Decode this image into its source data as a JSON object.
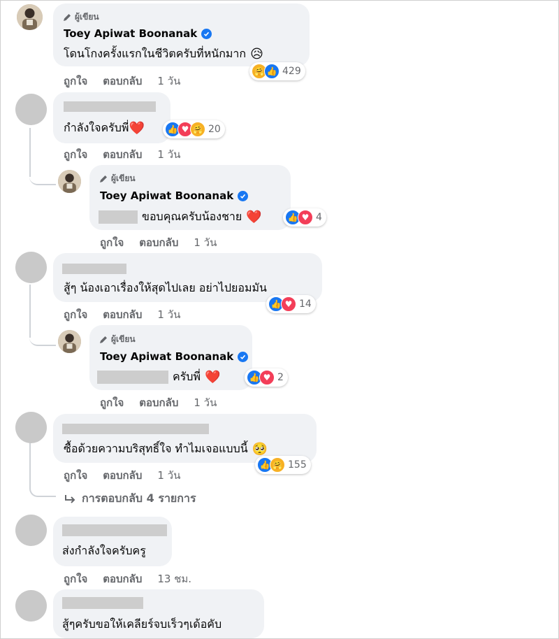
{
  "labels": {
    "author_tag": "ผู้เขียน",
    "like": "ถูกใจ",
    "reply": "ตอบกลับ"
  },
  "comments": [
    {
      "name": "Toey Apiwat Boonanak",
      "text": "โดนโกงครั้งแรกในชีวิตครับที่หนักมาก",
      "emoji": "😥",
      "time": "1 วัน",
      "reactions": [
        "care",
        "like"
      ],
      "count": "429"
    },
    {
      "text": "กำลังใจครับพี่",
      "emoji": "❤️",
      "time": "1 วัน",
      "reactions": [
        "like",
        "love",
        "care"
      ],
      "count": "20"
    },
    {
      "name": "Toey Apiwat Boonanak",
      "text": "ขอบคุณครับน้องชาย",
      "emoji": "❤️",
      "time": "1 วัน",
      "reactions": [
        "like",
        "love"
      ],
      "count": "4"
    },
    {
      "text": "สู้ๆ น้องเอาเรื่องให้สุดไปเลย อย่าไปยอมมัน",
      "time": "1 วัน",
      "reactions": [
        "like",
        "love"
      ],
      "count": "14"
    },
    {
      "name": "Toey Apiwat Boonanak",
      "text": "ครับพี่",
      "emoji": "❤️",
      "time": "1 วัน",
      "reactions": [
        "like",
        "love"
      ],
      "count": "2"
    },
    {
      "text": "ซื้อด้วยความบริสุทธิ์ใจ ทำไมเจอแบบนี้",
      "emoji": "🥺",
      "time": "1 วัน",
      "reactions": [
        "like",
        "care"
      ],
      "count": "155"
    },
    {
      "text": "ส่งกำลังใจครับครู",
      "time": "13 ชม."
    },
    {
      "text": "สู้ๆครับขอให้เคลียร์จบเร็วๆเด้อคับ"
    }
  ],
  "more_replies": "การตอบกลับ 4 รายการ",
  "icons": {
    "like": "thumbs-up-icon",
    "love": "heart-icon",
    "care": "care-hug-icon",
    "author": "pencil-icon",
    "verified": "verified-badge-icon",
    "reply_arrow": "reply-arrow-icon"
  },
  "colors": {
    "like": "#1877f2",
    "love": "#f33e58",
    "care": "#f7b125",
    "bubble": "#f0f2f5",
    "meta": "#65676b"
  }
}
